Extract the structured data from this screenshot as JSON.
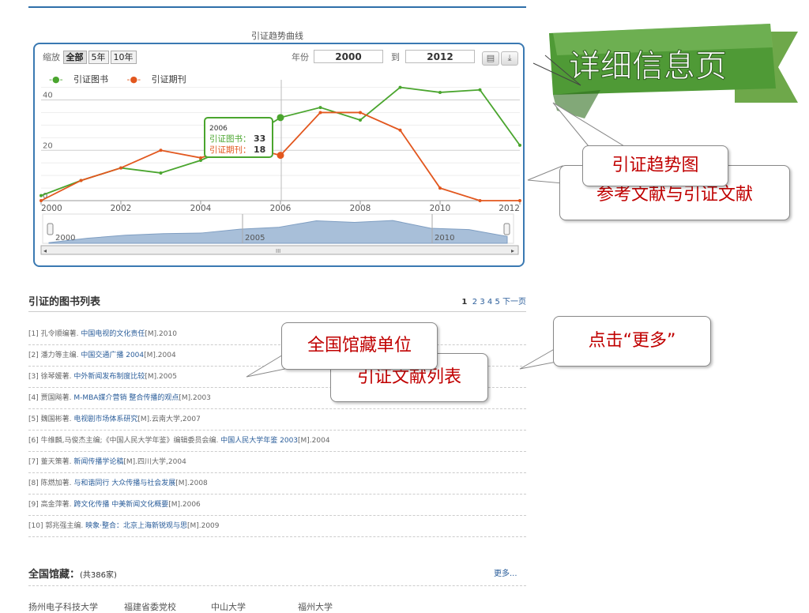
{
  "chart": {
    "title": "引证趋势曲线",
    "zoom_label": "缩放",
    "zoom_buttons": [
      "全部",
      "5年",
      "10年"
    ],
    "year_label": "年份",
    "year_from": "2000",
    "to_label": "到",
    "year_to": "2012",
    "tooltip": {
      "year": "2006",
      "books_label": "引证图书：",
      "books_value": "33",
      "journals_label": "引证期刊：",
      "journals_value": "18"
    },
    "navigator_labels": [
      "2000",
      "2005",
      "2010"
    ],
    "scroll_mid": "III"
  },
  "chart_data": {
    "type": "line",
    "title": "引证趋势曲线",
    "x": [
      2000,
      2001,
      2002,
      2003,
      2004,
      2005,
      2006,
      2007,
      2008,
      2009,
      2010,
      2011,
      2012
    ],
    "series": [
      {
        "name": "引证图书",
        "color": "#4aa52e",
        "values": [
          2,
          8,
          13,
          11,
          16,
          23,
          33,
          37,
          32,
          45,
          43,
          44,
          22
        ]
      },
      {
        "name": "引证期刊",
        "color": "#e2571e",
        "values": [
          0,
          8,
          13,
          20,
          17,
          22,
          18,
          35,
          35,
          28,
          5,
          0,
          0
        ]
      }
    ],
    "x_ticks": [
      2000,
      2002,
      2004,
      2006,
      2008,
      2010,
      2012
    ],
    "y_ticks": [
      0,
      20,
      40
    ],
    "xlim": [
      2000,
      2012
    ],
    "ylim": [
      0,
      48
    ],
    "grid": true,
    "legend": "top-left"
  },
  "books": {
    "title": "引证的图书列表",
    "pages": [
      "1",
      "2",
      "3",
      "4",
      "5"
    ],
    "next": "下一页",
    "items": [
      {
        "pre": "[1] 孔令顺编著.",
        "t": "中国电视的文化责任",
        "post": "[M].2010"
      },
      {
        "pre": "[2] 潘力等主编.",
        "t": "中国交通广播 2004",
        "post": "[M].2004"
      },
      {
        "pre": "[3] 徐琴媛著.",
        "t": "中外新闻发布制度比较",
        "post": "[M].2005"
      },
      {
        "pre": "[4] 贾国飚著.",
        "t": "M-MBA媒介营销 整合传播的观点",
        "post": "[M].2003"
      },
      {
        "pre": "[5] 魏国彬著.",
        "t": "电视剧市场体系研究",
        "post": "[M].云南大学,2007"
      },
      {
        "pre": "[6] 牛维麟,马俊杰主编;《中国人民大学年鉴》编辑委员会编.",
        "t": "中国人民大学年鉴 2003",
        "post": "[M].2004"
      },
      {
        "pre": "[7] 董天策著.",
        "t": "新闻传播学论稿",
        "post": "[M].四川大学,2004"
      },
      {
        "pre": "[8] 陈燃加著.",
        "t": "与和谐同行 大众传播与社会发展",
        "post": "[M].2008"
      },
      {
        "pre": "[9] 高金萍著.",
        "t": "跨文化传播 中美新闻文化概要",
        "post": "[M].2006"
      },
      {
        "pre": "[10] 郭兆强主编.",
        "t": "映象·整合：北京上海新锐观与思",
        "post": "[M].2009"
      }
    ]
  },
  "libraries": {
    "title": "全国馆藏：",
    "count": "(共386家)",
    "more": "更多...",
    "partial": "扬州电子科技大学　　　福建省委党校　　　　中山大学　　　　　　福州大学"
  },
  "callouts": {
    "banner": "详细信息页",
    "trend": "引证趋势图",
    "refs": "参考文献与引证文献",
    "holdings": "全国馆藏单位",
    "citelist": "引证文献列表",
    "more": "点击“更多”"
  }
}
